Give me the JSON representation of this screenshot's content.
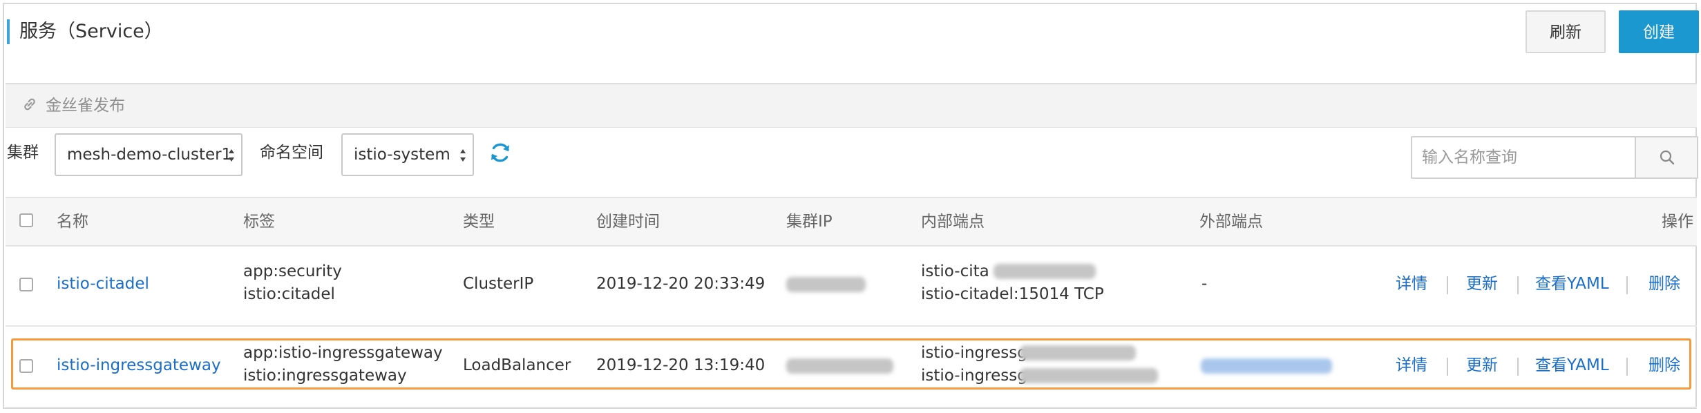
{
  "header": {
    "title": "服务（Service）",
    "refresh_label": "刷新",
    "create_label": "创建"
  },
  "canary": {
    "label": "金丝雀发布",
    "icon": "link-icon"
  },
  "filters": {
    "cluster_label": "集群",
    "cluster_value": "mesh-demo-cluster1",
    "namespace_label": "命名空间",
    "namespace_value": "istio-system",
    "search_placeholder": "输入名称查询"
  },
  "table": {
    "columns": [
      "名称",
      "标签",
      "类型",
      "创建时间",
      "集群IP",
      "内部端点",
      "外部端点",
      "操作"
    ],
    "rows": [
      {
        "name": "istio-citadel",
        "labels": [
          "app:security",
          "istio:citadel"
        ],
        "type": "ClusterIP",
        "created": "2019-12-20 20:33:49",
        "internal": [
          "istio-cita",
          "istio-citadel:15014 TCP"
        ],
        "external": "-"
      },
      {
        "name": "istio-ingressgateway",
        "labels": [
          "app:istio-ingressgateway",
          "istio:ingressgateway"
        ],
        "type": "LoadBalancer",
        "created": "2019-12-20 13:19:40",
        "internal": [
          "istio-ingressg",
          "istio-ingressg"
        ],
        "external": ""
      }
    ],
    "actions": {
      "detail": "详情",
      "update": "更新",
      "view_yaml": "查看YAML",
      "delete": "删除"
    }
  },
  "colors": {
    "accent": "#1a98cf",
    "link": "#1a6ec7",
    "highlight": "#f39a3c"
  }
}
